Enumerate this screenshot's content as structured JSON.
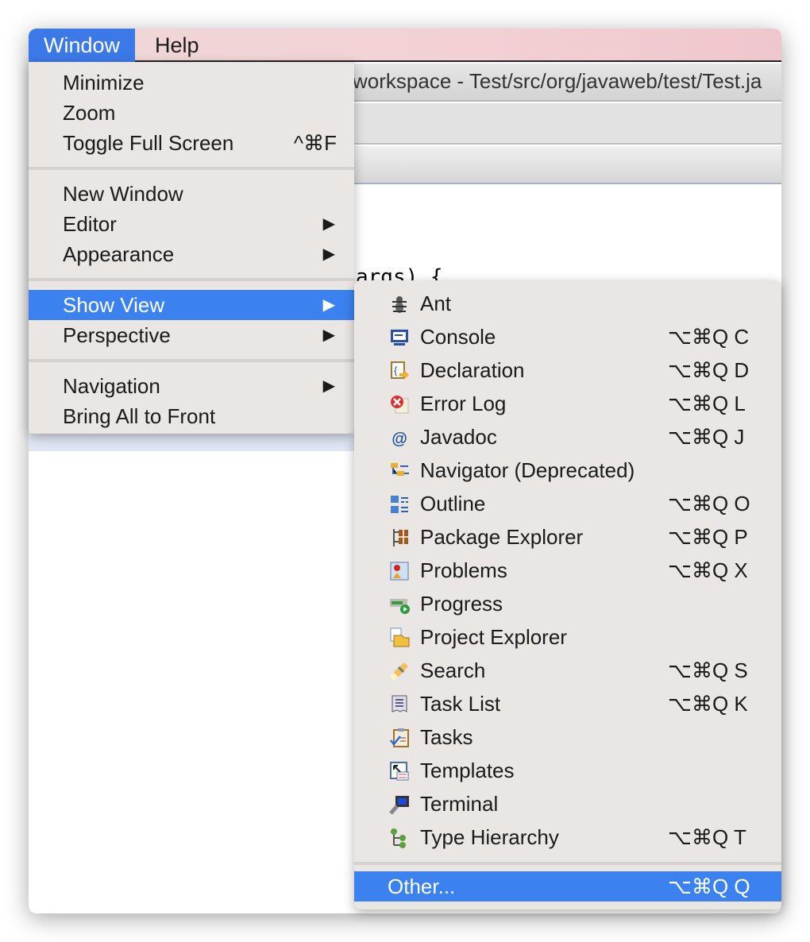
{
  "menubar": {
    "items": [
      {
        "label": "Window",
        "active": true
      },
      {
        "label": "Help",
        "active": false
      }
    ]
  },
  "window_title": "workspace - Test/src/org/javaweb/test/Test.ja",
  "code_fragment": "args) {",
  "window_menu": {
    "groups": [
      [
        {
          "label": "Minimize"
        },
        {
          "label": "Zoom"
        },
        {
          "label": "Toggle Full Screen",
          "shortcut": "^⌘F"
        }
      ],
      [
        {
          "label": "New Window"
        },
        {
          "label": "Editor",
          "submenu": true
        },
        {
          "label": "Appearance",
          "submenu": true
        }
      ],
      [
        {
          "label": "Show View",
          "submenu": true,
          "highlighted": true
        },
        {
          "label": "Perspective",
          "submenu": true
        }
      ],
      [
        {
          "label": "Navigation",
          "submenu": true
        },
        {
          "label": "Bring All to Front"
        }
      ]
    ]
  },
  "show_view_menu": {
    "items": [
      {
        "label": "Ant",
        "icon": "ant-icon",
        "shortcut": ""
      },
      {
        "label": "Console",
        "icon": "console-icon",
        "shortcut": "⌥⌘Q C"
      },
      {
        "label": "Declaration",
        "icon": "declaration-icon",
        "shortcut": "⌥⌘Q D"
      },
      {
        "label": "Error Log",
        "icon": "error-log-icon",
        "shortcut": "⌥⌘Q L"
      },
      {
        "label": "Javadoc",
        "icon": "javadoc-icon",
        "shortcut": "⌥⌘Q J"
      },
      {
        "label": "Navigator (Deprecated)",
        "icon": "navigator-icon",
        "shortcut": ""
      },
      {
        "label": "Outline",
        "icon": "outline-icon",
        "shortcut": "⌥⌘Q O"
      },
      {
        "label": "Package Explorer",
        "icon": "package-explorer-icon",
        "shortcut": "⌥⌘Q P"
      },
      {
        "label": "Problems",
        "icon": "problems-icon",
        "shortcut": "⌥⌘Q X"
      },
      {
        "label": "Progress",
        "icon": "progress-icon",
        "shortcut": ""
      },
      {
        "label": "Project Explorer",
        "icon": "project-explorer-icon",
        "shortcut": ""
      },
      {
        "label": "Search",
        "icon": "search-icon",
        "shortcut": "⌥⌘Q S"
      },
      {
        "label": "Task List",
        "icon": "task-list-icon",
        "shortcut": "⌥⌘Q K"
      },
      {
        "label": "Tasks",
        "icon": "tasks-icon",
        "shortcut": ""
      },
      {
        "label": "Templates",
        "icon": "templates-icon",
        "shortcut": ""
      },
      {
        "label": "Terminal",
        "icon": "terminal-icon",
        "shortcut": ""
      },
      {
        "label": "Type Hierarchy",
        "icon": "type-hierarchy-icon",
        "shortcut": "⌥⌘Q T"
      }
    ],
    "other": {
      "label": "Other...",
      "shortcut": "⌥⌘Q Q"
    }
  },
  "colors": {
    "highlight": "#3b82f0",
    "menu_bg": "#e9e6e4"
  }
}
